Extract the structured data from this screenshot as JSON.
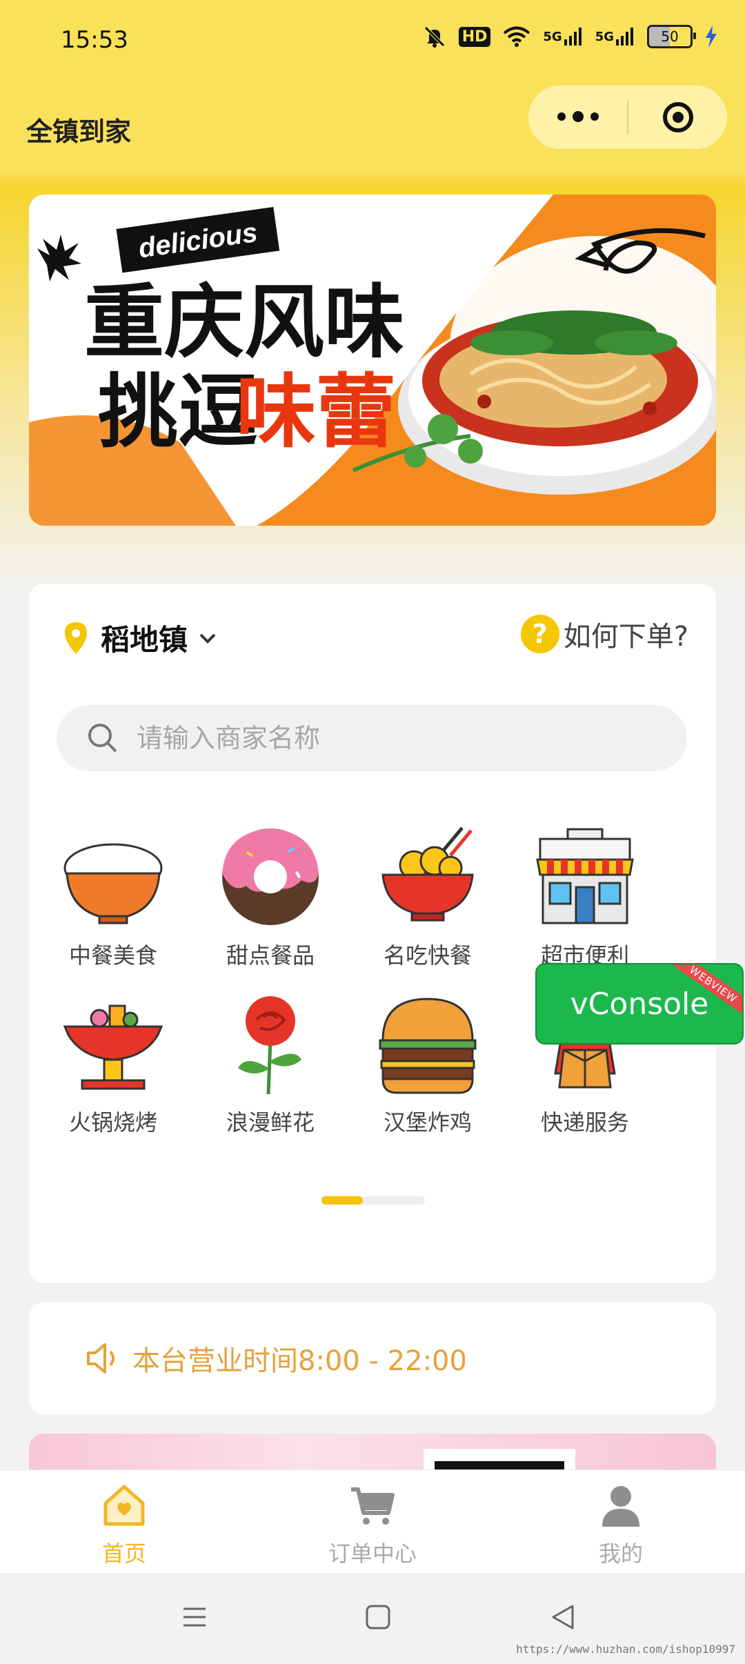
{
  "status_bar": {
    "time": "15:53",
    "hd": "HD",
    "net1": "5G",
    "net2": "5G",
    "battery": "50"
  },
  "nav": {
    "title": "全镇到家"
  },
  "banner": {
    "tag": "delicious",
    "line1": "重庆风味",
    "line2_black": "挑逗",
    "line2_orange": "味蕾"
  },
  "location": {
    "town": "稻地镇",
    "help_label": "如何下单?"
  },
  "search": {
    "placeholder": "请输入商家名称"
  },
  "categories": [
    {
      "label": "中餐美食",
      "icon": "rice-bowl-icon"
    },
    {
      "label": "甜点餐品",
      "icon": "donut-icon"
    },
    {
      "label": "名吃快餐",
      "icon": "noodle-bowl-icon"
    },
    {
      "label": "超市便利",
      "icon": "store-icon"
    },
    {
      "label": "火锅烧烤",
      "icon": "hotpot-icon"
    },
    {
      "label": "浪漫鲜花",
      "icon": "rose-icon"
    },
    {
      "label": "汉堡炸鸡",
      "icon": "burger-icon"
    },
    {
      "label": "快递服务",
      "icon": "courier-icon"
    }
  ],
  "vconsole": {
    "label": "vConsole",
    "ribbon": "WEBVIEW"
  },
  "notice": {
    "text": "本台营业时间8:00 - 22:00"
  },
  "tabbar": {
    "items": [
      {
        "label": "首页",
        "active": true
      },
      {
        "label": "订单中心",
        "active": false
      },
      {
        "label": "我的",
        "active": false
      }
    ]
  },
  "watermark": "https://www.huzhan.com/ishop10997",
  "colors": {
    "accent": "#f5c700",
    "notice": "#e3a23a",
    "tab_active": "#f2b626"
  }
}
